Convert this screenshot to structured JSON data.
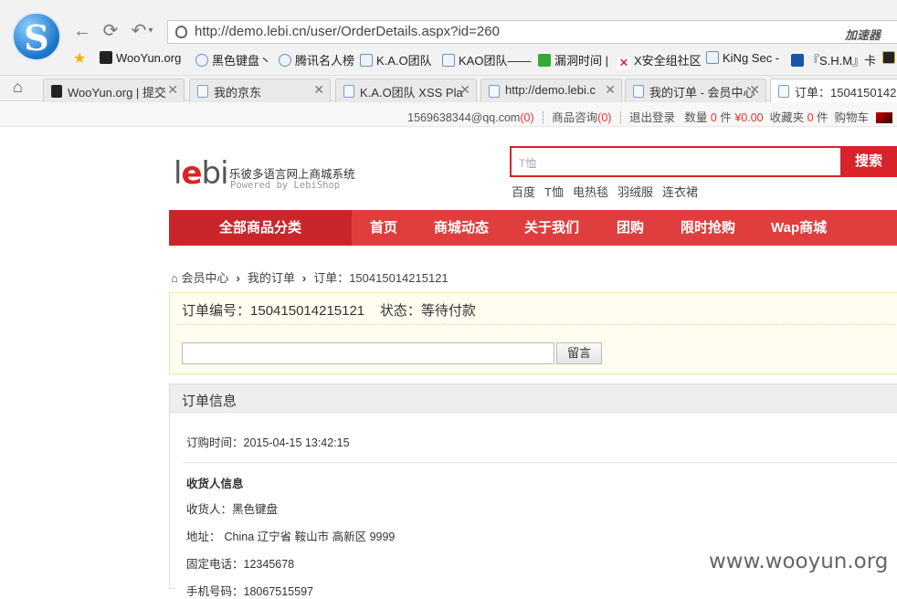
{
  "browser": {
    "url": "http://demo.lebi.cn/user/OrderDetails.aspx?id=260",
    "accelerator": "加速器",
    "bookmarks": [
      "WooYun.org",
      "黑色键盘丶",
      "腾讯名人榜",
      "K.A.O团队",
      "KAO团队——",
      "漏洞时间 |",
      "X安全组社区",
      "KiNg Sec -",
      "『S.H.M』卡"
    ],
    "tabs": [
      "WooYun.org | 提交",
      "我的京东",
      "K.A.O团队 XSS Pla",
      "http://demo.lebi.c",
      "我的订单 - 会员中心",
      "订单：1504150142"
    ]
  },
  "topbar": {
    "email": "1569638344@qq.com",
    "email_count": "(0)",
    "consult": "商品咨询",
    "consult_count": "(0)",
    "logout": "退出登录",
    "qty_label": "数量",
    "qty": "0",
    "qty_unit": "件",
    "amount": "¥0.00",
    "fav_label": "收藏夹",
    "fav": "0",
    "fav_unit": "件",
    "cart": "购物车"
  },
  "logo": {
    "mark_l": "l",
    "mark_e": "e",
    "mark_rest": "bi",
    "title": "乐彼多语言网上商城系统",
    "powered": "Powered by LebiShop"
  },
  "search": {
    "placeholder": "T恤",
    "button": "搜索",
    "hot": [
      "百度",
      "T恤",
      "电热毯",
      "羽绒服",
      "连衣裙"
    ]
  },
  "nav": {
    "all": "全部商品分类",
    "items": [
      "首页",
      "商城动态",
      "关于我们",
      "团购",
      "限时抢购",
      "Wap商城"
    ]
  },
  "breadcrumb": {
    "home": "会员中心",
    "orders": "我的订单",
    "current": "订单：150415014215121"
  },
  "order": {
    "number_label": "订单编号：",
    "number": "150415014215121",
    "status_label": "状态：",
    "status": "等待付款",
    "message_button": "留言"
  },
  "info": {
    "title": "订单信息",
    "time_label": "订购时间：",
    "time": "2015-04-15 13:42:15",
    "receiver_title": "收货人信息",
    "receiver_label": "收货人：",
    "receiver": "黑色键盘",
    "address_label": "地址：",
    "address": "China 辽宁省 鞍山市 高新区 9999",
    "phone_label": "固定电话：",
    "phone": "12345678",
    "mobile_label": "手机号码：",
    "mobile": "18067515597"
  },
  "watermark": "www.wooyun.org"
}
